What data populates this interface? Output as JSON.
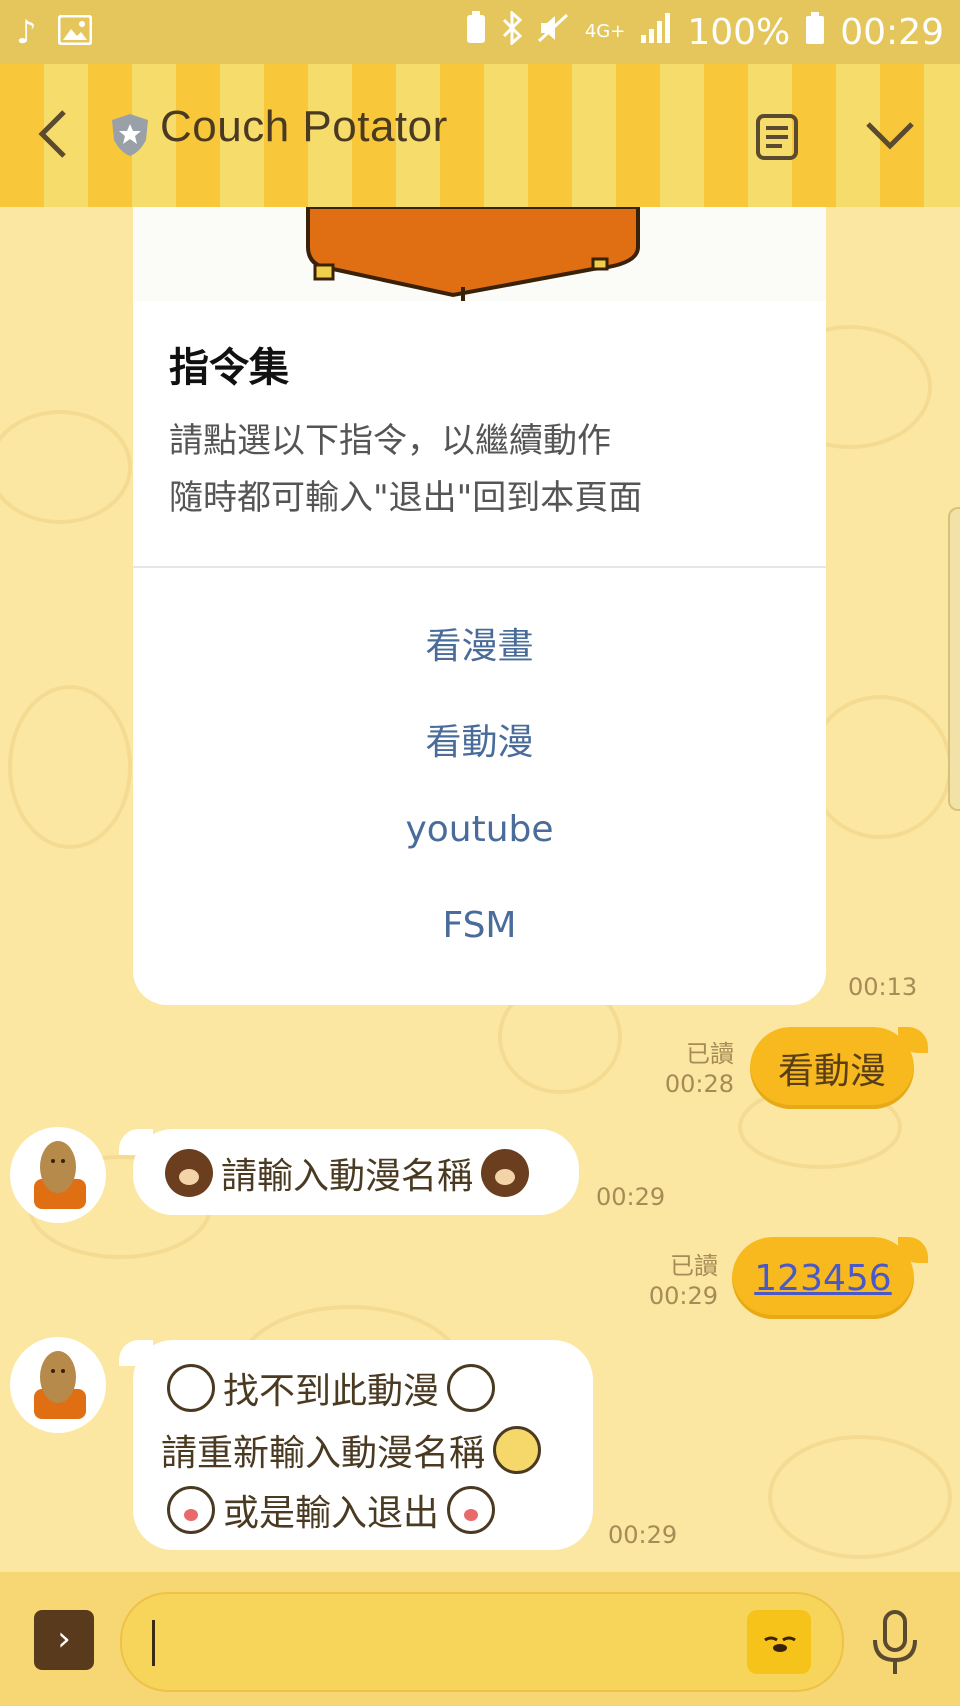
{
  "status_bar": {
    "network": "4G+",
    "battery": "100%",
    "time": "00:29"
  },
  "header": {
    "title": "Couch Potator"
  },
  "card": {
    "title": "指令集",
    "desc_line1": "請點選以下指令，以繼續動作",
    "desc_line2": "隨時都可輸入\"退出\"回到本頁面",
    "actions": [
      "看漫畫",
      "看動漫",
      "youtube",
      "FSM"
    ],
    "time": "00:13"
  },
  "messages": [
    {
      "side": "right",
      "text": "看動漫",
      "read": "已讀",
      "time": "00:28"
    },
    {
      "side": "left",
      "text": "請輸入動漫名稱",
      "time": "00:29"
    },
    {
      "side": "right",
      "text": "123456",
      "read": "已讀",
      "time": "00:29"
    },
    {
      "side": "left",
      "line1": "找不到此動漫",
      "line2": "請重新輸入動漫名稱",
      "line3": "或是輸入退出",
      "time": "00:29"
    }
  ],
  "input": {
    "placeholder": ""
  },
  "colors": {
    "accent": "#f7b91d",
    "link": "#4a6c9a",
    "header_stripe_a": "#f8c83a",
    "header_stripe_b": "#f6dc6a"
  },
  "icons": [
    "music-icon",
    "image-icon",
    "bluetooth-icon",
    "mute-icon",
    "signal-icon",
    "battery-icon",
    "back-icon",
    "shield-icon",
    "menu-icon",
    "chevron-down-icon",
    "expand-icon",
    "sticker-icon",
    "mic-icon"
  ]
}
